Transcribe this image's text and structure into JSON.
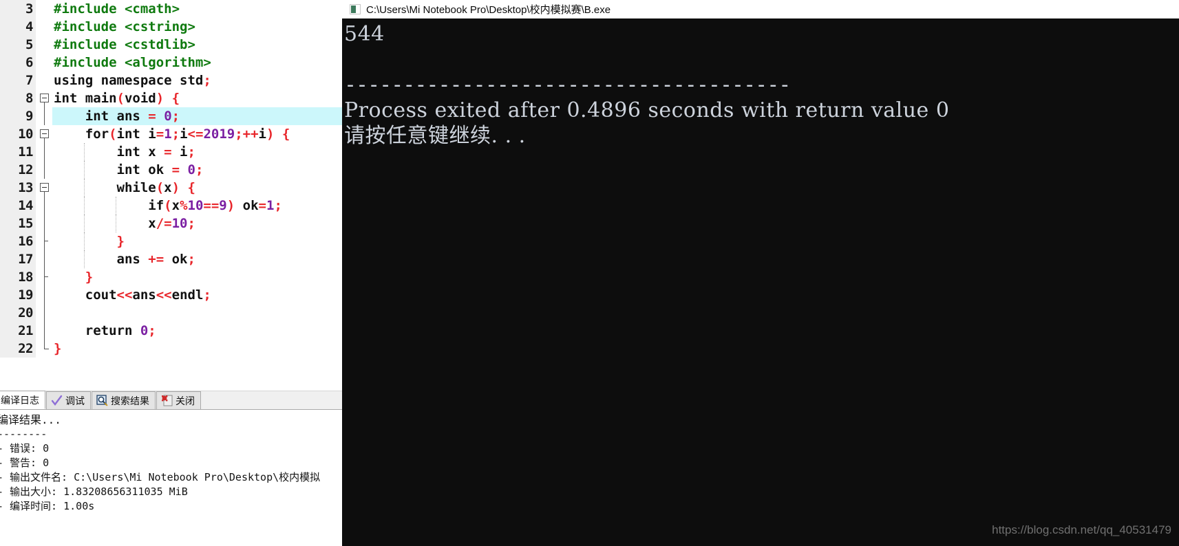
{
  "editor": {
    "highlighted_line": 9,
    "lines": [
      {
        "num": "3",
        "fold": "none",
        "indent_guides": [],
        "tokens": [
          {
            "t": "#include ",
            "c": "pre"
          },
          {
            "t": "<cmath>",
            "c": "pre"
          }
        ]
      },
      {
        "num": "4",
        "fold": "none",
        "indent_guides": [],
        "tokens": [
          {
            "t": "#include ",
            "c": "pre"
          },
          {
            "t": "<cstring>",
            "c": "pre"
          }
        ]
      },
      {
        "num": "5",
        "fold": "none",
        "indent_guides": [],
        "tokens": [
          {
            "t": "#include ",
            "c": "pre"
          },
          {
            "t": "<cstdlib>",
            "c": "pre"
          }
        ]
      },
      {
        "num": "6",
        "fold": "none",
        "indent_guides": [],
        "tokens": [
          {
            "t": "#include ",
            "c": "pre"
          },
          {
            "t": "<algorithm>",
            "c": "pre"
          }
        ]
      },
      {
        "num": "7",
        "fold": "none",
        "indent_guides": [],
        "tokens": [
          {
            "t": "using namespace std",
            "c": "kw"
          },
          {
            "t": ";",
            "c": "punc"
          }
        ]
      },
      {
        "num": "8",
        "fold": "box",
        "indent_guides": [],
        "tokens": [
          {
            "t": "int main",
            "c": "kw"
          },
          {
            "t": "(",
            "c": "punc"
          },
          {
            "t": "void",
            "c": "kw"
          },
          {
            "t": ")",
            "c": "punc"
          },
          {
            "t": " ",
            "c": "kw"
          },
          {
            "t": "{",
            "c": "punc"
          }
        ]
      },
      {
        "num": "9",
        "fold": "line",
        "indent_guides": [],
        "tokens": [
          {
            "t": "    int ans ",
            "c": "kw"
          },
          {
            "t": "=",
            "c": "op"
          },
          {
            "t": " ",
            "c": "kw"
          },
          {
            "t": "0",
            "c": "num"
          },
          {
            "t": ";",
            "c": "punc"
          }
        ]
      },
      {
        "num": "10",
        "fold": "box",
        "indent_guides": [],
        "tokens": [
          {
            "t": "    for",
            "c": "kw"
          },
          {
            "t": "(",
            "c": "punc"
          },
          {
            "t": "int i",
            "c": "kw"
          },
          {
            "t": "=",
            "c": "op"
          },
          {
            "t": "1",
            "c": "num"
          },
          {
            "t": ";",
            "c": "punc"
          },
          {
            "t": "i",
            "c": "kw"
          },
          {
            "t": "<=",
            "c": "op"
          },
          {
            "t": "2019",
            "c": "num"
          },
          {
            "t": ";",
            "c": "punc"
          },
          {
            "t": "++",
            "c": "op"
          },
          {
            "t": "i",
            "c": "kw"
          },
          {
            "t": ")",
            "c": "punc"
          },
          {
            "t": " ",
            "c": "kw"
          },
          {
            "t": "{",
            "c": "punc"
          }
        ]
      },
      {
        "num": "11",
        "fold": "line",
        "indent_guides": [
          1
        ],
        "tokens": [
          {
            "t": "        int x ",
            "c": "kw"
          },
          {
            "t": "=",
            "c": "op"
          },
          {
            "t": " i",
            "c": "kw"
          },
          {
            "t": ";",
            "c": "punc"
          }
        ]
      },
      {
        "num": "12",
        "fold": "line",
        "indent_guides": [
          1
        ],
        "tokens": [
          {
            "t": "        int ok ",
            "c": "kw"
          },
          {
            "t": "=",
            "c": "op"
          },
          {
            "t": " ",
            "c": "kw"
          },
          {
            "t": "0",
            "c": "num"
          },
          {
            "t": ";",
            "c": "punc"
          }
        ]
      },
      {
        "num": "13",
        "fold": "box",
        "indent_guides": [
          1
        ],
        "tokens": [
          {
            "t": "        while",
            "c": "kw"
          },
          {
            "t": "(",
            "c": "punc"
          },
          {
            "t": "x",
            "c": "kw"
          },
          {
            "t": ")",
            "c": "punc"
          },
          {
            "t": " ",
            "c": "kw"
          },
          {
            "t": "{",
            "c": "punc"
          }
        ]
      },
      {
        "num": "14",
        "fold": "line",
        "indent_guides": [
          1,
          2
        ],
        "tokens": [
          {
            "t": "            if",
            "c": "kw"
          },
          {
            "t": "(",
            "c": "punc"
          },
          {
            "t": "x",
            "c": "kw"
          },
          {
            "t": "%",
            "c": "op"
          },
          {
            "t": "10",
            "c": "num"
          },
          {
            "t": "==",
            "c": "op"
          },
          {
            "t": "9",
            "c": "num"
          },
          {
            "t": ")",
            "c": "punc"
          },
          {
            "t": " ok",
            "c": "kw"
          },
          {
            "t": "=",
            "c": "op"
          },
          {
            "t": "1",
            "c": "num"
          },
          {
            "t": ";",
            "c": "punc"
          }
        ]
      },
      {
        "num": "15",
        "fold": "line",
        "indent_guides": [
          1,
          2
        ],
        "tokens": [
          {
            "t": "            x",
            "c": "kw"
          },
          {
            "t": "/=",
            "c": "op"
          },
          {
            "t": "10",
            "c": "num"
          },
          {
            "t": ";",
            "c": "punc"
          }
        ]
      },
      {
        "num": "16",
        "fold": "tick",
        "indent_guides": [
          1
        ],
        "tokens": [
          {
            "t": "        ",
            "c": "kw"
          },
          {
            "t": "}",
            "c": "punc"
          }
        ]
      },
      {
        "num": "17",
        "fold": "line",
        "indent_guides": [
          1
        ],
        "tokens": [
          {
            "t": "        ans ",
            "c": "kw"
          },
          {
            "t": "+=",
            "c": "op"
          },
          {
            "t": " ok",
            "c": "kw"
          },
          {
            "t": ";",
            "c": "punc"
          }
        ]
      },
      {
        "num": "18",
        "fold": "tick",
        "indent_guides": [],
        "tokens": [
          {
            "t": "    ",
            "c": "kw"
          },
          {
            "t": "}",
            "c": "punc"
          }
        ]
      },
      {
        "num": "19",
        "fold": "line",
        "indent_guides": [],
        "tokens": [
          {
            "t": "    cout",
            "c": "kw"
          },
          {
            "t": "<<",
            "c": "op"
          },
          {
            "t": "ans",
            "c": "kw"
          },
          {
            "t": "<<",
            "c": "op"
          },
          {
            "t": "endl",
            "c": "kw"
          },
          {
            "t": ";",
            "c": "punc"
          }
        ]
      },
      {
        "num": "20",
        "fold": "line",
        "indent_guides": [],
        "tokens": [
          {
            "t": "",
            "c": "kw"
          }
        ]
      },
      {
        "num": "21",
        "fold": "line",
        "indent_guides": [],
        "tokens": [
          {
            "t": "    return ",
            "c": "kw"
          },
          {
            "t": "0",
            "c": "num"
          },
          {
            "t": ";",
            "c": "punc"
          }
        ]
      },
      {
        "num": "22",
        "fold": "end",
        "indent_guides": [],
        "tokens": [
          {
            "t": "}",
            "c": "punc"
          }
        ]
      }
    ]
  },
  "bottom_panel": {
    "tabs": [
      {
        "label": "编译日志",
        "icon": "log-icon",
        "active": true
      },
      {
        "label": "调试",
        "icon": "check-icon",
        "active": false
      },
      {
        "label": "搜索结果",
        "icon": "search-icon",
        "active": false
      },
      {
        "label": "关闭",
        "icon": "close-icon",
        "active": false
      }
    ],
    "log_lines": [
      "编译结果...",
      "--------",
      "- 错误: 0",
      "- 警告: 0",
      "- 输出文件名: C:\\Users\\Mi Notebook Pro\\Desktop\\校内模拟",
      "- 输出大小: 1.83208656311035 MiB",
      "- 编译时间: 1.00s"
    ]
  },
  "console": {
    "title": "C:\\Users\\Mi Notebook Pro\\Desktop\\校内模拟赛\\B.exe",
    "icon": "console-app-icon",
    "output_value": "544",
    "separator": "--------------------------------------",
    "exit_line": "Process exited after 0.4896 seconds with return value 0",
    "prompt_line": "请按任意键继续. . ."
  },
  "watermark": {
    "text": "https://blog.csdn.net/qq_40531479"
  },
  "colors": {
    "preprocessor": "#0f7a0f",
    "operator": "#e8262b",
    "number": "#7b1fa2",
    "highlight_line": "#ccf7fb",
    "gutter_bg": "#efefef",
    "console_bg": "#0d0d0d",
    "console_fg": "#cdd3dc"
  }
}
